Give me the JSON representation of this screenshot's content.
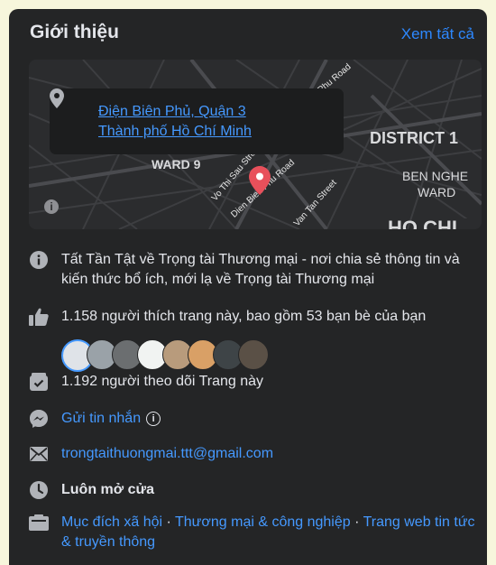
{
  "header": {
    "title": "Giới thiệu",
    "see_all": "Xem tất cả"
  },
  "map": {
    "address_line1": "Điện Biên Phủ, Quận 3",
    "address_line2": "Thành phố Hồ Chí Minh",
    "labels": {
      "ward9": "WARD 9",
      "district1": "DISTRICT 1",
      "bennghe1": "BEN NGHE",
      "bennghe2": "WARD",
      "hochi": "HO CHI",
      "vothisau": "Vo Thi Sau Street",
      "dienbienphu_road": "Dien Bien Phu Road",
      "vantan": "Van Tan Street",
      "phuroad": "Phu Road"
    }
  },
  "about": {
    "description": "Tất Tần Tật về Trọng tài Thương mại - nơi chia sẻ thông tin và kiến thức bổ ích, mới lạ về Trọng tài Thương mại",
    "likes": "1.158 người thích trang này, bao gồm 53 bạn bè của bạn",
    "followers": "1.192 người theo dõi Trang này",
    "message": "Gửi tin nhắn",
    "email": "trongtaithuongmai.ttt@gmail.com",
    "hours": "Luôn mở cửa",
    "categories": [
      "Mục đích xã hội",
      "Thương mại & công nghiệp",
      "Trang web tin tức & truyền thông"
    ],
    "category_separator": " · "
  },
  "colors": {
    "card": "#242526",
    "link": "#4599ff",
    "open": "#45bd62",
    "text": "#e4e6eb"
  }
}
